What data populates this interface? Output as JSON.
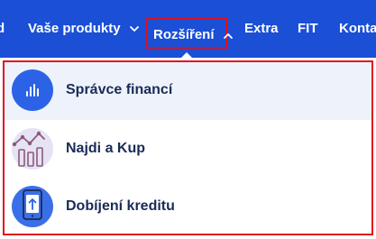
{
  "nav": {
    "items": [
      {
        "label": "d"
      },
      {
        "label": "Vaše produkty"
      },
      {
        "label": "Rozšíření"
      },
      {
        "label": "Extra"
      },
      {
        "label": "FIT"
      },
      {
        "label": "Kontakt"
      }
    ],
    "active_index": 2
  },
  "dropdown": {
    "items": [
      {
        "label": "Správce financí",
        "icon": "bar-chart-icon"
      },
      {
        "label": "Najdi a Kup",
        "icon": "chart-trend-icon"
      },
      {
        "label": "Dobíjení kreditu",
        "icon": "phone-topup-icon"
      }
    ]
  },
  "colors": {
    "nav_bg": "#1a4fd6",
    "highlight_border": "#e0101e",
    "label_text": "#1a2b57",
    "active_item_bg": "#eef2fb"
  }
}
